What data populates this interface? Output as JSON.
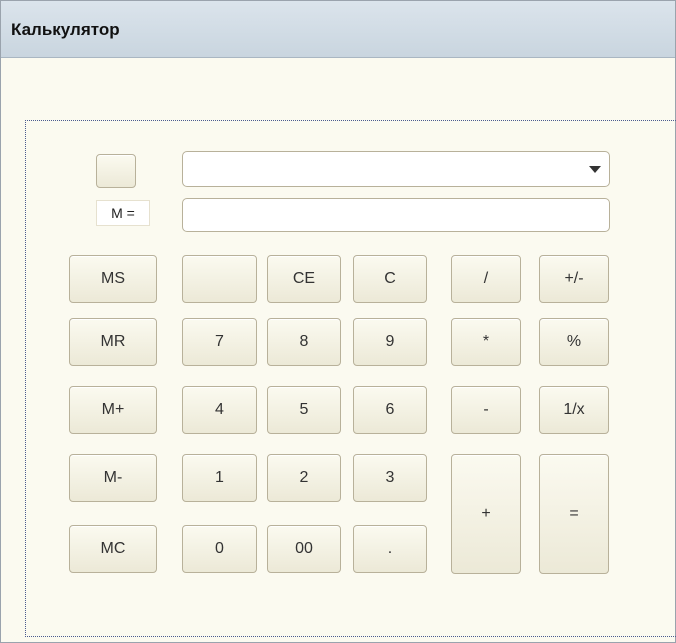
{
  "window": {
    "title": "Калькулятор"
  },
  "memory": {
    "label": "M ="
  },
  "buttons": {
    "ms": "MS",
    "mr": "MR",
    "mplus": "M+",
    "mminus": "M-",
    "mc": "MC",
    "blank": "",
    "ce": "CE",
    "c": "C",
    "seven": "7",
    "eight": "8",
    "nine": "9",
    "four": "4",
    "five": "5",
    "six": "6",
    "one": "1",
    "two": "2",
    "three": "3",
    "zero": "0",
    "double_zero": "00",
    "decimal": ".",
    "divide": "/",
    "multiply": "*",
    "subtract": "-",
    "add": "+",
    "plus_minus": "+/-",
    "percent": "%",
    "reciprocal": "1/x",
    "equals": "="
  },
  "icons": {
    "dropdown": "chevron-down-icon"
  }
}
